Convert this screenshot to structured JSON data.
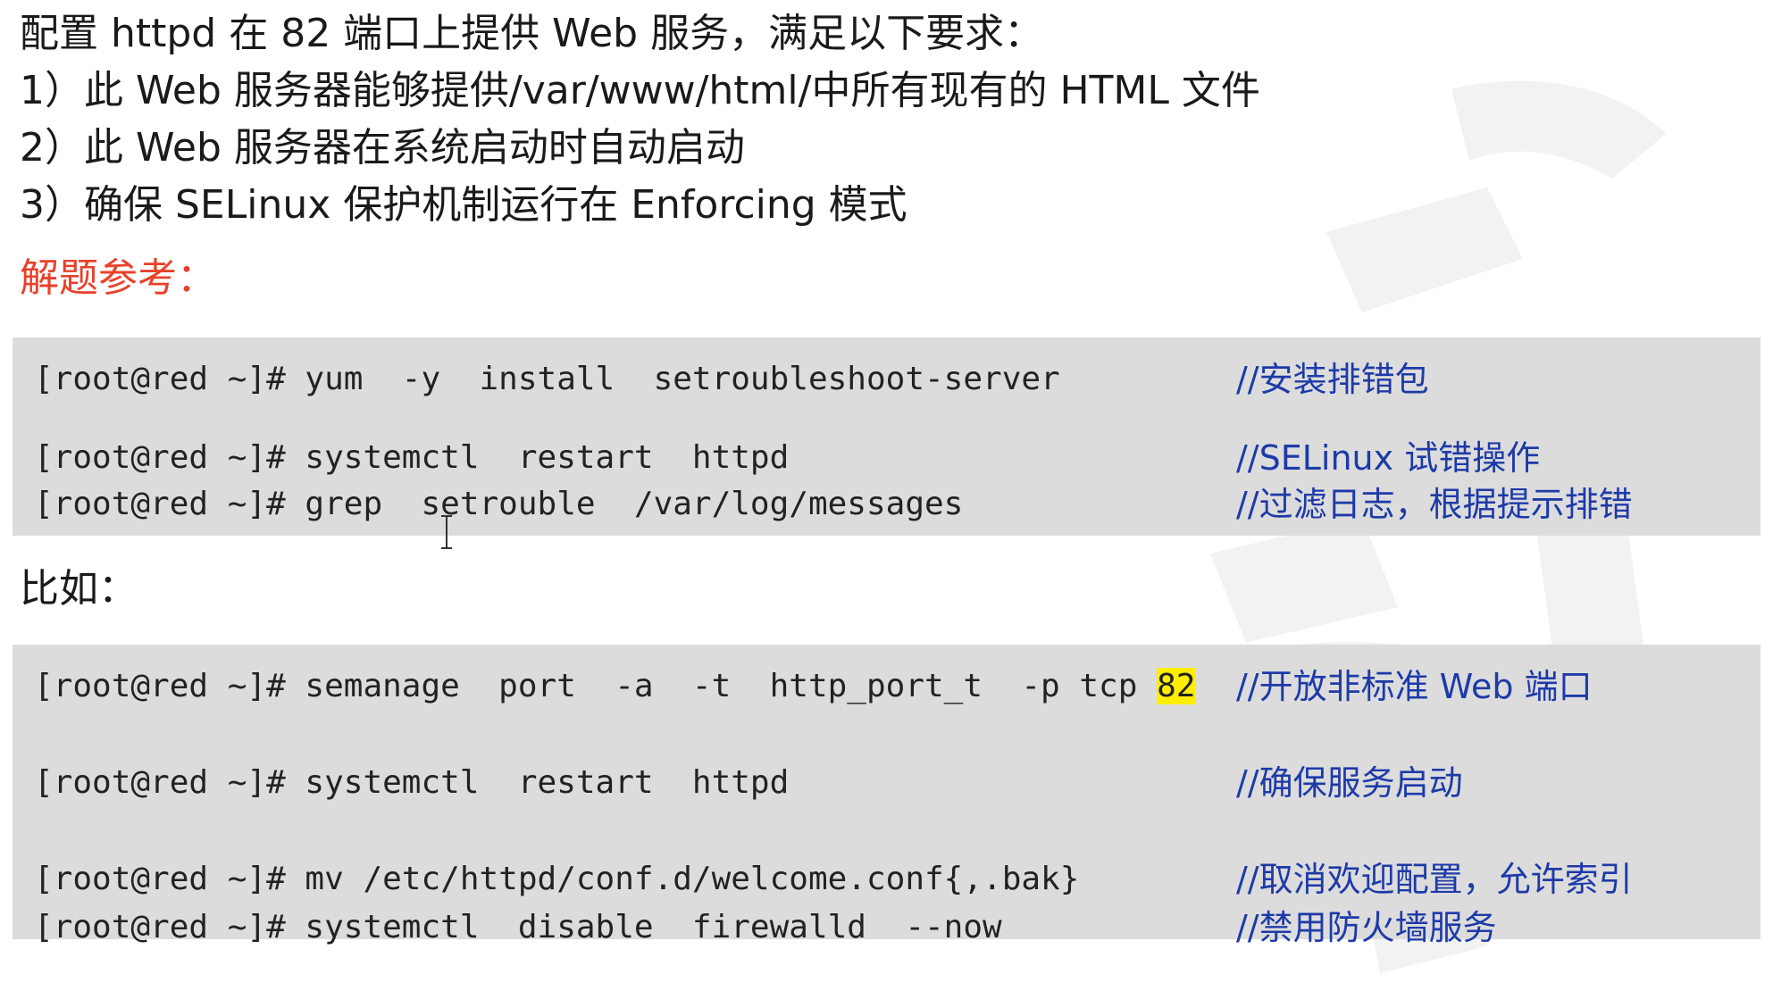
{
  "task": {
    "lines": [
      "配置 httpd 在 82 端口上提供 Web 服务，满足以下要求：",
      "1）此 Web 服务器能够提供/var/www/html/中所有现有的 HTML 文件",
      "2）此 Web 服务器在系统启动时自动启动",
      "3）确保 SELinux 保护机制运行在 Enforcing 模式"
    ]
  },
  "answer_heading": "解题参考：",
  "block1": {
    "rows": [
      {
        "cmd": "[root@red ~]# yum  -y  install  setroubleshoot-server",
        "comment": "//安装排错包"
      },
      {
        "cmd": "[root@red ~]# systemctl  restart  httpd",
        "comment": "//SELinux 试错操作"
      },
      {
        "cmd": "[root@red ~]# grep  setrouble  /var/log/messages",
        "comment": "//过滤日志，根据提示排错"
      }
    ]
  },
  "example_heading": "比如：",
  "block2": {
    "rows": [
      {
        "cmd": "[root@red ~]# semanage  port  -a  -t  http_port_t  -p tcp ",
        "highlight": "82",
        "comment": "//开放非标准 Web 端口"
      },
      {
        "cmd": "[root@red ~]# systemctl  restart  httpd",
        "comment": "//确保服务启动"
      },
      {
        "cmd": "[root@red ~]# mv /etc/httpd/conf.d/welcome.conf{,.bak}",
        "comment": "//取消欢迎配置，允许索引"
      },
      {
        "cmd": "[root@red ~]# systemctl  disable  firewalld  --now",
        "comment": "//禁用防火墙服务"
      }
    ]
  },
  "colors": {
    "heading_red": "#e8412b",
    "comment_blue": "#1e3aa8",
    "code_bg": "#dcdcdc",
    "highlight": "#ffee00"
  }
}
